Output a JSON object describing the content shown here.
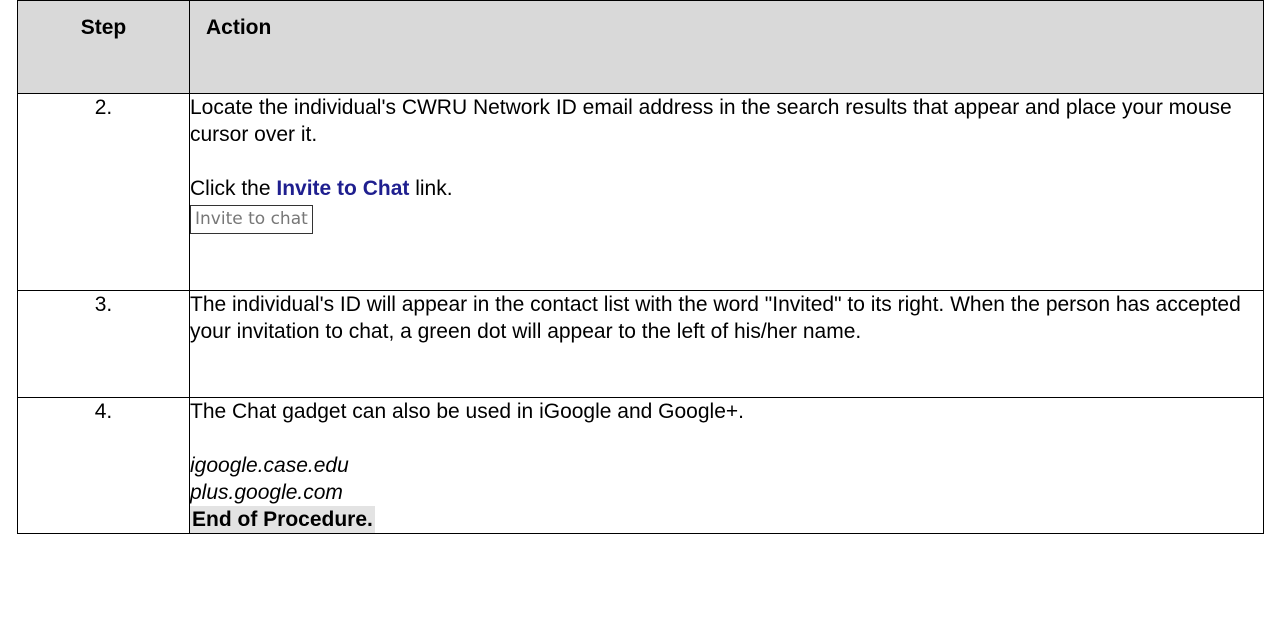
{
  "table": {
    "header": {
      "step": "Step",
      "action": "Action"
    },
    "rows": [
      {
        "step": "2.",
        "text1": "Locate the individual's CWRU Network ID email address in the search results that appear and place your mouse cursor over it.",
        "click_prefix": "Click the ",
        "click_link": "Invite to Chat",
        "click_suffix": " link.",
        "button_label": "Invite to chat"
      },
      {
        "step": "3.",
        "text": "The individual's ID will appear in the contact list with the word \"Invited\" to its right. When the person has accepted your invitation to chat, a green dot will appear to the left of his/her name."
      },
      {
        "step": "4.",
        "text": "The Chat gadget can also be used in iGoogle and Google+.",
        "link1": "igoogle.case.edu",
        "link2": "plus.google.com",
        "end": "End of Procedure."
      }
    ]
  }
}
